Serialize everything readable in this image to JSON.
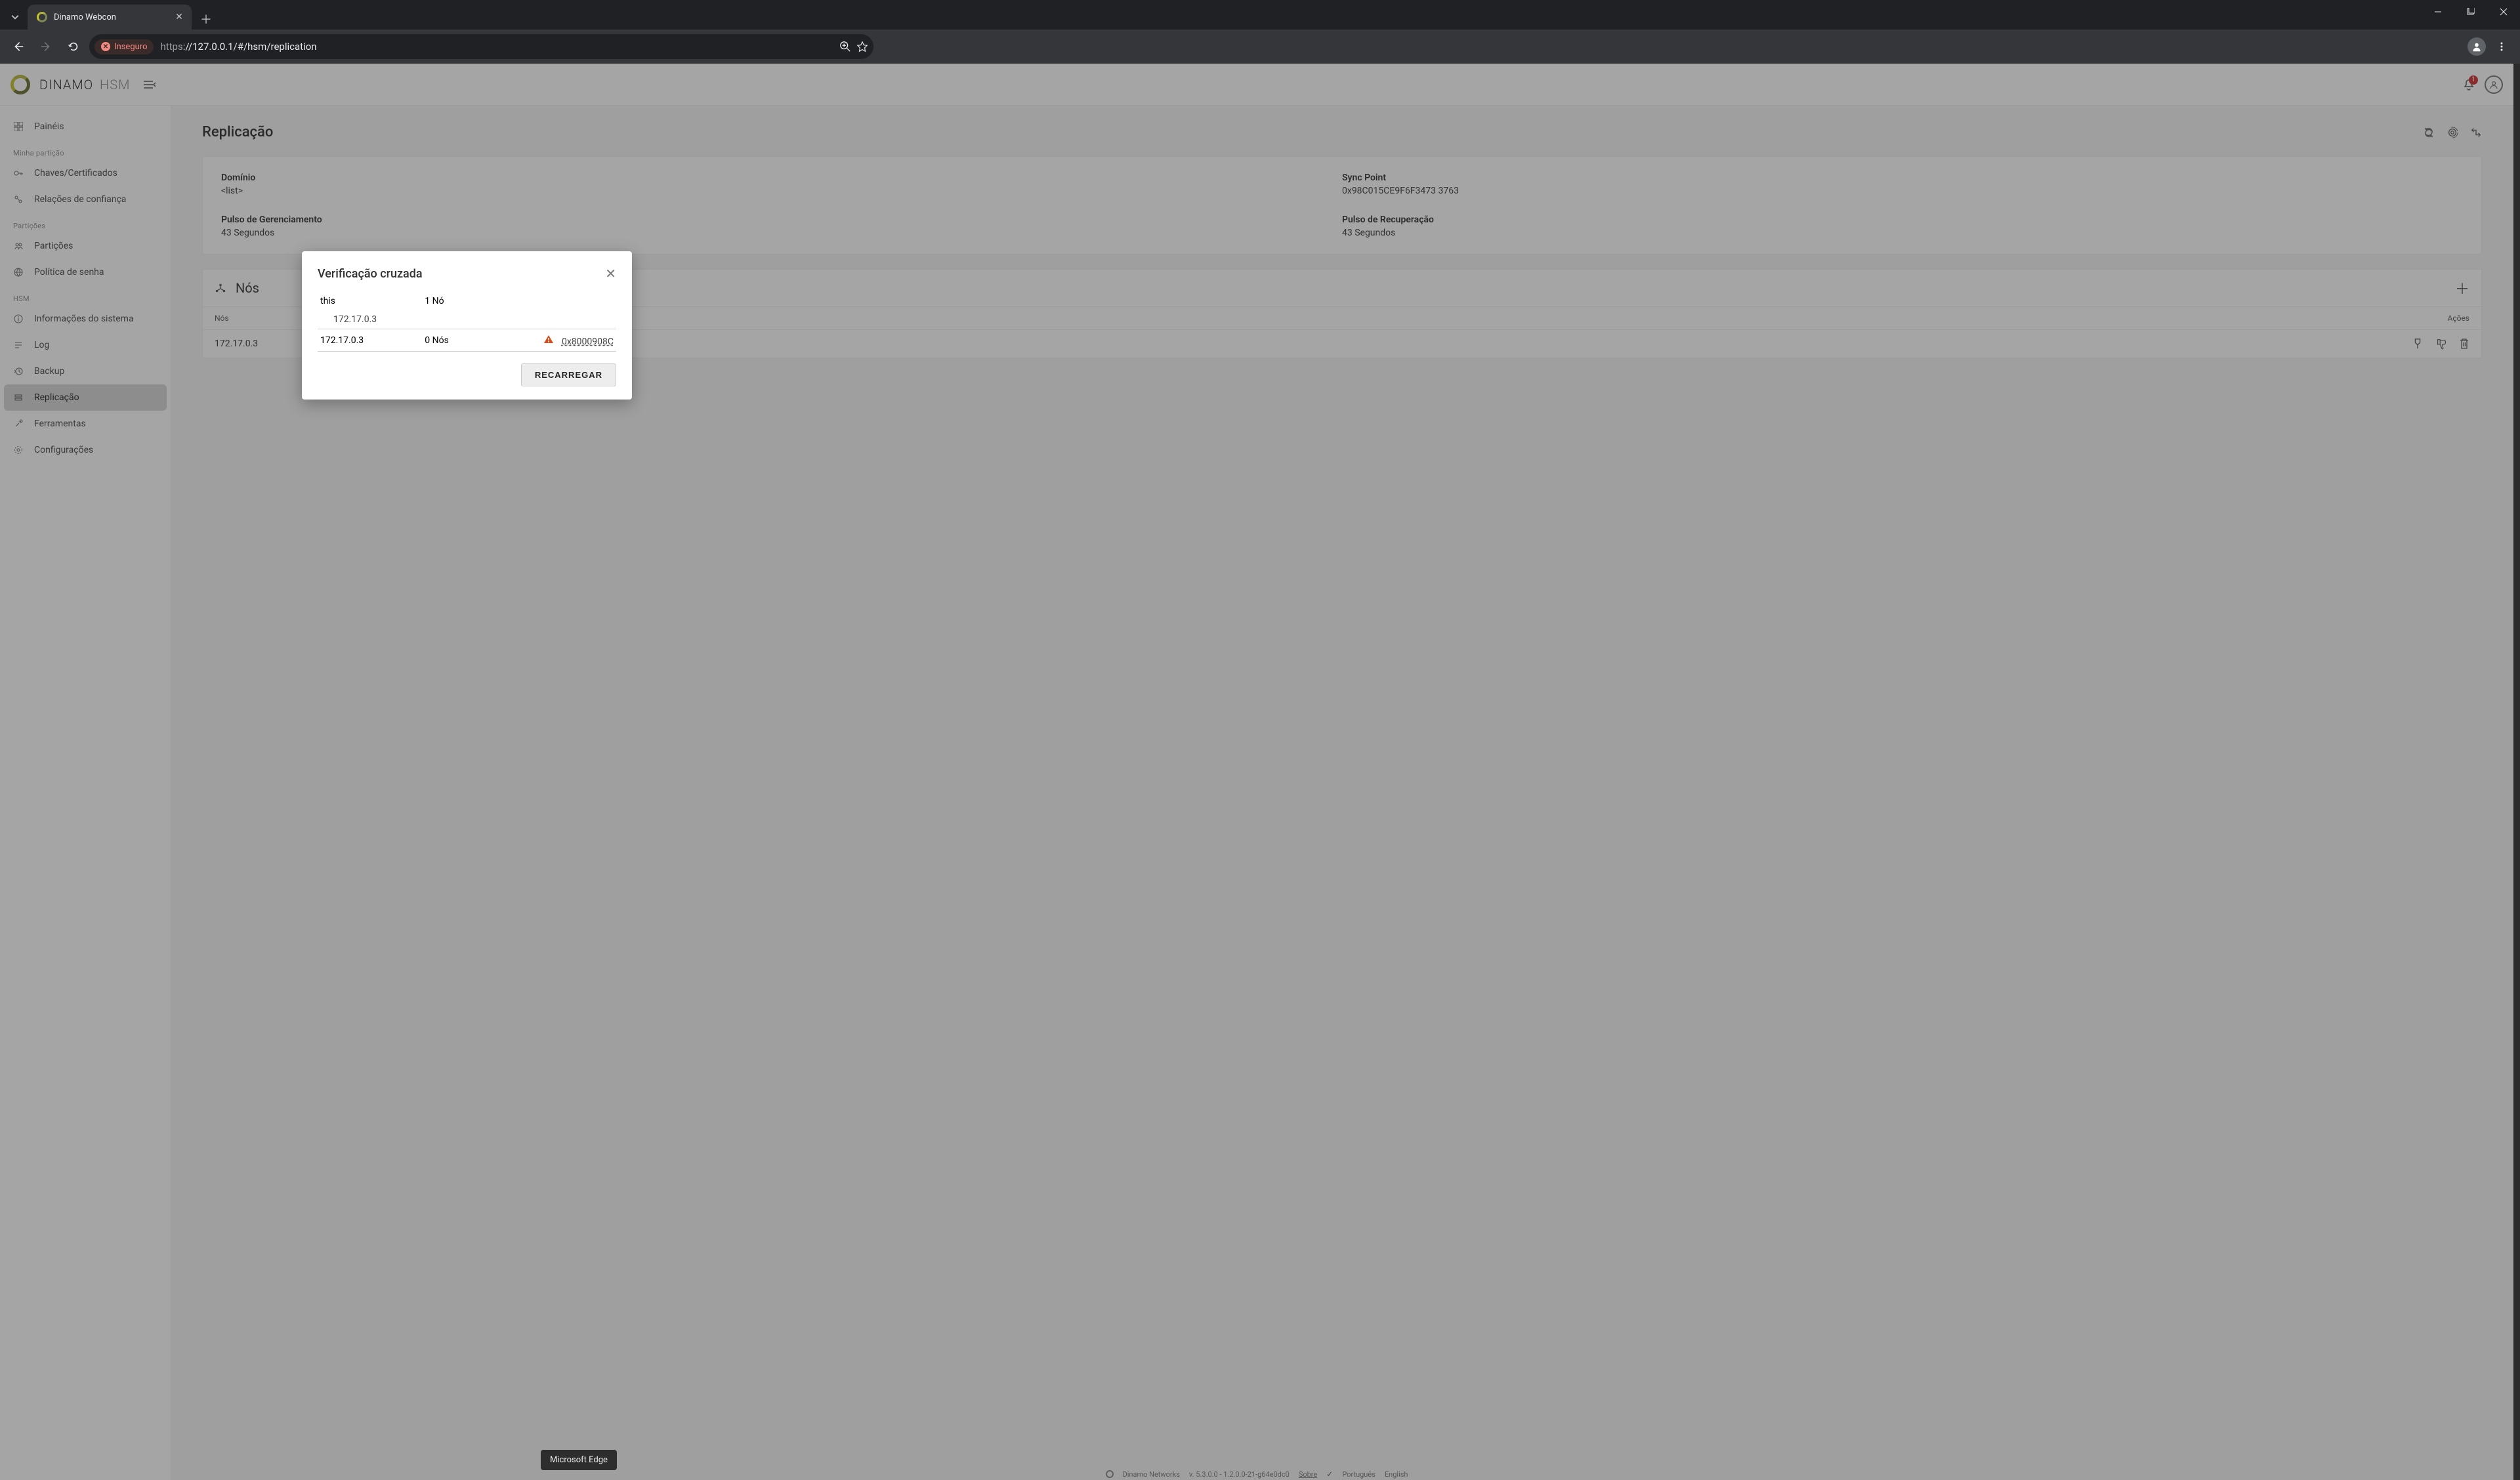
{
  "browser": {
    "tab_title": "Dinamo Webcon",
    "insecure_label": "Inseguro",
    "url_scheme": "https",
    "url_rest": "://127.0.0.1/#/hsm/replication",
    "tooltip": "Microsoft Edge"
  },
  "header": {
    "brand_main": "DINAMO",
    "brand_sub": "HSM",
    "notif_count": "1"
  },
  "sidebar": {
    "items": [
      {
        "label": "Painéis"
      }
    ],
    "section1": "Minha partição",
    "sec1_items": [
      {
        "label": "Chaves/Certificados"
      },
      {
        "label": "Relações de confiança"
      }
    ],
    "section2": "Partições",
    "sec2_items": [
      {
        "label": "Partições"
      },
      {
        "label": "Política de senha"
      }
    ],
    "section3": "HSM",
    "sec3_items": [
      {
        "label": "Informações do sistema"
      },
      {
        "label": "Log"
      },
      {
        "label": "Backup"
      },
      {
        "label": "Replicação"
      },
      {
        "label": "Ferramentas"
      },
      {
        "label": "Configurações"
      }
    ]
  },
  "page": {
    "title": "Replicação",
    "info": {
      "dominio_label": "Domínio",
      "dominio_value": "<list>",
      "sync_label": "Sync Point",
      "sync_value": "0x98C015CE9F6F3473 3763",
      "pulso_g_label": "Pulso de Gerenciamento",
      "pulso_g_value": "43 Segundos",
      "pulso_r_label": "Pulso de Recuperação",
      "pulso_r_value": "43 Segundos"
    },
    "nodes_title": "Nós",
    "tbl_head_nodes": "Nós",
    "tbl_head_actions": "Ações",
    "row_ip": "172.17.0.3"
  },
  "modal": {
    "title": "Verificação cruzada",
    "r1_name": "this",
    "r1_count": "1 Nó",
    "r1_sub": "172.17.0.3",
    "r2_name": "172.17.0.3",
    "r2_count": "0 Nós",
    "r2_err": "0x8000908C",
    "reload": "RECARREGAR"
  },
  "footer": {
    "company": "Dinamo Networks",
    "version": "v. 5.3.0.0 - 1.2.0.0-21-g64e0dc0",
    "about": "Sobre",
    "lang_pt": "Português",
    "lang_en": "English"
  }
}
